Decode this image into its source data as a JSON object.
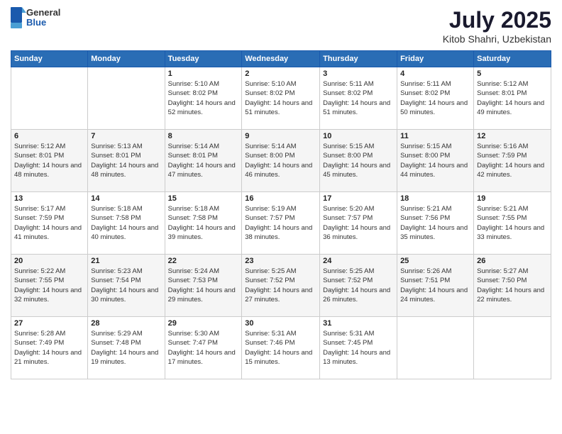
{
  "logo": {
    "general": "General",
    "blue": "Blue"
  },
  "header": {
    "month": "July 2025",
    "location": "Kitob Shahri, Uzbekistan"
  },
  "weekdays": [
    "Sunday",
    "Monday",
    "Tuesday",
    "Wednesday",
    "Thursday",
    "Friday",
    "Saturday"
  ],
  "weeks": [
    [
      null,
      null,
      {
        "day": 1,
        "sunrise": "5:10 AM",
        "sunset": "8:02 PM",
        "daylight": "14 hours and 52 minutes."
      },
      {
        "day": 2,
        "sunrise": "5:10 AM",
        "sunset": "8:02 PM",
        "daylight": "14 hours and 51 minutes."
      },
      {
        "day": 3,
        "sunrise": "5:11 AM",
        "sunset": "8:02 PM",
        "daylight": "14 hours and 51 minutes."
      },
      {
        "day": 4,
        "sunrise": "5:11 AM",
        "sunset": "8:02 PM",
        "daylight": "14 hours and 50 minutes."
      },
      {
        "day": 5,
        "sunrise": "5:12 AM",
        "sunset": "8:01 PM",
        "daylight": "14 hours and 49 minutes."
      }
    ],
    [
      {
        "day": 6,
        "sunrise": "5:12 AM",
        "sunset": "8:01 PM",
        "daylight": "14 hours and 48 minutes."
      },
      {
        "day": 7,
        "sunrise": "5:13 AM",
        "sunset": "8:01 PM",
        "daylight": "14 hours and 48 minutes."
      },
      {
        "day": 8,
        "sunrise": "5:14 AM",
        "sunset": "8:01 PM",
        "daylight": "14 hours and 47 minutes."
      },
      {
        "day": 9,
        "sunrise": "5:14 AM",
        "sunset": "8:00 PM",
        "daylight": "14 hours and 46 minutes."
      },
      {
        "day": 10,
        "sunrise": "5:15 AM",
        "sunset": "8:00 PM",
        "daylight": "14 hours and 45 minutes."
      },
      {
        "day": 11,
        "sunrise": "5:15 AM",
        "sunset": "8:00 PM",
        "daylight": "14 hours and 44 minutes."
      },
      {
        "day": 12,
        "sunrise": "5:16 AM",
        "sunset": "7:59 PM",
        "daylight": "14 hours and 42 minutes."
      }
    ],
    [
      {
        "day": 13,
        "sunrise": "5:17 AM",
        "sunset": "7:59 PM",
        "daylight": "14 hours and 41 minutes."
      },
      {
        "day": 14,
        "sunrise": "5:18 AM",
        "sunset": "7:58 PM",
        "daylight": "14 hours and 40 minutes."
      },
      {
        "day": 15,
        "sunrise": "5:18 AM",
        "sunset": "7:58 PM",
        "daylight": "14 hours and 39 minutes."
      },
      {
        "day": 16,
        "sunrise": "5:19 AM",
        "sunset": "7:57 PM",
        "daylight": "14 hours and 38 minutes."
      },
      {
        "day": 17,
        "sunrise": "5:20 AM",
        "sunset": "7:57 PM",
        "daylight": "14 hours and 36 minutes."
      },
      {
        "day": 18,
        "sunrise": "5:21 AM",
        "sunset": "7:56 PM",
        "daylight": "14 hours and 35 minutes."
      },
      {
        "day": 19,
        "sunrise": "5:21 AM",
        "sunset": "7:55 PM",
        "daylight": "14 hours and 33 minutes."
      }
    ],
    [
      {
        "day": 20,
        "sunrise": "5:22 AM",
        "sunset": "7:55 PM",
        "daylight": "14 hours and 32 minutes."
      },
      {
        "day": 21,
        "sunrise": "5:23 AM",
        "sunset": "7:54 PM",
        "daylight": "14 hours and 30 minutes."
      },
      {
        "day": 22,
        "sunrise": "5:24 AM",
        "sunset": "7:53 PM",
        "daylight": "14 hours and 29 minutes."
      },
      {
        "day": 23,
        "sunrise": "5:25 AM",
        "sunset": "7:52 PM",
        "daylight": "14 hours and 27 minutes."
      },
      {
        "day": 24,
        "sunrise": "5:25 AM",
        "sunset": "7:52 PM",
        "daylight": "14 hours and 26 minutes."
      },
      {
        "day": 25,
        "sunrise": "5:26 AM",
        "sunset": "7:51 PM",
        "daylight": "14 hours and 24 minutes."
      },
      {
        "day": 26,
        "sunrise": "5:27 AM",
        "sunset": "7:50 PM",
        "daylight": "14 hours and 22 minutes."
      }
    ],
    [
      {
        "day": 27,
        "sunrise": "5:28 AM",
        "sunset": "7:49 PM",
        "daylight": "14 hours and 21 minutes."
      },
      {
        "day": 28,
        "sunrise": "5:29 AM",
        "sunset": "7:48 PM",
        "daylight": "14 hours and 19 minutes."
      },
      {
        "day": 29,
        "sunrise": "5:30 AM",
        "sunset": "7:47 PM",
        "daylight": "14 hours and 17 minutes."
      },
      {
        "day": 30,
        "sunrise": "5:31 AM",
        "sunset": "7:46 PM",
        "daylight": "14 hours and 15 minutes."
      },
      {
        "day": 31,
        "sunrise": "5:31 AM",
        "sunset": "7:45 PM",
        "daylight": "14 hours and 13 minutes."
      },
      null,
      null
    ]
  ]
}
